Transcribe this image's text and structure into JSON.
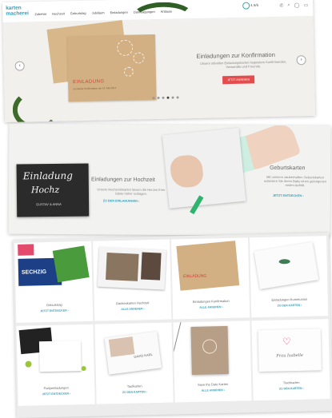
{
  "header": {
    "logo_line1": "karten",
    "logo_line2": "macherei",
    "nav": [
      "Zubehör",
      "Hochzeit",
      "Geburtstag",
      "Jubiläum",
      "Einladungen",
      "Danksagungen",
      "Anlässe"
    ],
    "rating": "4.9/5"
  },
  "hero": {
    "card_title": "EINLADUNG",
    "card_subtitle": "zu meiner Konfirmation am 14. Mai 2017",
    "title": "Einladungen zur Konfirmation",
    "text": "Unsere stilvollen Einladungskarten begeistern Konfirmanden, Verwandte und Freunde.",
    "button": "JETZT ANSEHEN",
    "prev": "‹",
    "next": "›",
    "slide_count": 6,
    "active_slide": 3
  },
  "mid": {
    "chalk_line1": "Einladung",
    "chalk_line2": "Hochz",
    "chalk_line3": "GUSTAV & ANNA",
    "left_title": "Einladungen zur Hochzeit",
    "left_text": "Unsere Hochzeitskarten lassen die Herzen Ihrer Gäste höher schlagen.",
    "left_link": "ZU DEN EINLADUNGEN ›",
    "right_title": "Geburtskarten",
    "right_text": "Mit unseren zauberhaften Geburtskarten schenken Sie ihrem Baby einen gelungenen ersten Auftritt.",
    "right_link": "JETZT ENTDECKEN ›"
  },
  "tiles": [
    {
      "name": "Geburtstag",
      "link": "JETZT ENTDECKEN ›",
      "label": "SECHZIG"
    },
    {
      "name": "Dankeskarten Hochzeit",
      "link": "ALLE ANSEHEN ›",
      "label": ""
    },
    {
      "name": "Einladungen Konfirmation",
      "link": "ALLE ANSEHEN ›",
      "label": "EINLADUNG"
    },
    {
      "name": "Einladungen Kommunion",
      "link": "ZU DEN KARTEN ›",
      "label": ""
    },
    {
      "name": "Partyeinladungen",
      "link": "JETZT ENTDECKEN ›",
      "label": ""
    },
    {
      "name": "Taufkarten",
      "link": "ZU DEN KARTEN ›",
      "label": "DAVID KARL"
    },
    {
      "name": "Save the Date Karten",
      "link": "ALLE ANSEHEN ›",
      "label": ""
    },
    {
      "name": "Tischkarten",
      "link": "ZU DEN KARTEN ›",
      "label": "Frau Isabelle"
    }
  ],
  "colors": {
    "accent": "#2a9fbc",
    "button": "#e64c4c",
    "kraft": "#d3b083"
  }
}
